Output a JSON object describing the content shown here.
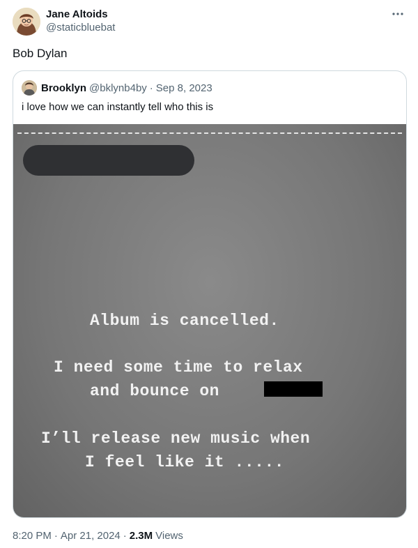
{
  "post": {
    "author_name": "Jane Altoids",
    "author_handle": "@staticbluebat",
    "text": "Bob Dylan",
    "time": "8:20 PM",
    "date": "Apr 21, 2024",
    "views_count": "2.3M",
    "views_label": "Views",
    "separator": "·"
  },
  "quote": {
    "author_name": "Brooklyn",
    "author_handle": "@bklynb4by",
    "separator": "·",
    "date": "Sep 8, 2023",
    "text": "i love how we can instantly tell who this is",
    "image_text": {
      "line1": "Album is cancelled.",
      "line2": "I need some time to relax",
      "line3": "and bounce on",
      "line4": "I’ll release new music when",
      "line5": "I feel like it ....."
    }
  },
  "icons": {
    "more": "more-horizontal-icon"
  },
  "colors": {
    "text_primary": "#0f1419",
    "text_secondary": "#536471",
    "border": "#cfd9de",
    "image_bg": "#767676"
  }
}
